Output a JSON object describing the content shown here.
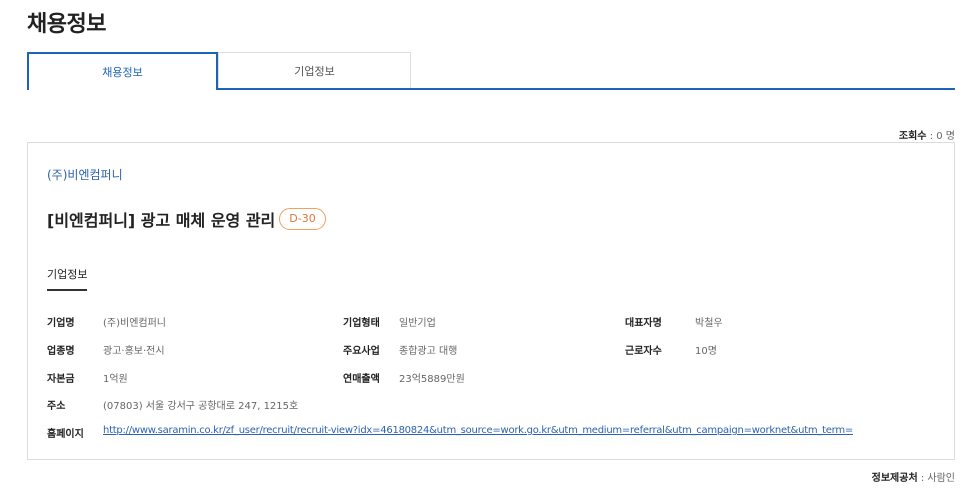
{
  "page": {
    "title": "채용정보"
  },
  "tabs": [
    {
      "label": "채용정보",
      "active": true
    },
    {
      "label": "기업정보",
      "active": false
    }
  ],
  "views": {
    "label": "조회수",
    "value": "0 명"
  },
  "job": {
    "company": "(주)비엔컴퍼니",
    "title": "[비엔컴퍼니] 광고 매체 운영 관리",
    "dday": "D-30"
  },
  "company_info": {
    "section_title": "기업정보",
    "rows": [
      [
        {
          "label": "기업명",
          "value": "(주)비엔컴퍼니"
        },
        {
          "label": "기업형태",
          "value": "일반기업"
        },
        {
          "label": "대표자명",
          "value": "박철우"
        }
      ],
      [
        {
          "label": "업종명",
          "value": "광고·홍보·전시"
        },
        {
          "label": "주요사업",
          "value": "종합광고 대행"
        },
        {
          "label": "근로자수",
          "value": "10명"
        }
      ],
      [
        {
          "label": "자본금",
          "value": "1억원"
        },
        {
          "label": "연매출액",
          "value": "23억5889만원"
        }
      ]
    ],
    "address": {
      "label": "주소",
      "value": "(07803) 서울 강서구 공항대로 247, 1215호"
    },
    "homepage": {
      "label": "홈페이지",
      "value": "http://www.saramin.co.kr/zf_user/recruit/recruit-view?idx=46180824&utm_source=work.go.kr&utm_medium=referral&utm_campaign=worknet&utm_term="
    }
  },
  "source": {
    "label": "정보제공처",
    "value": "사람인"
  },
  "colors": {
    "accent": "#1f63b7",
    "link": "#2d62b0",
    "dday": "#e0793a"
  }
}
